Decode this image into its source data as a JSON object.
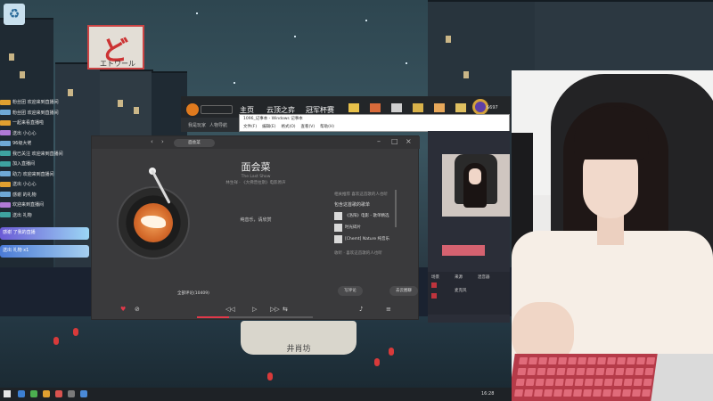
{
  "desktop": {
    "sign_text": "エトワール",
    "sign_glyph": "ど",
    "boat_text": "井肖坊"
  },
  "chat": {
    "messages": [
      {
        "badge": "#e0a030",
        "text": "粉丝团 欢迎来到直播间"
      },
      {
        "badge": "#6fa9d6",
        "text": "粉丝团 欢迎来到直播间"
      },
      {
        "badge": "#e0a030",
        "text": "一起来看直播啦"
      },
      {
        "badge": "#b07ad6",
        "text": "送出 小心心"
      },
      {
        "badge": "#6fa9d6",
        "text": "96级大佬"
      },
      {
        "badge": "#3ea3a0",
        "text": "我已关注 欢迎来到直播间"
      },
      {
        "badge": "#3ea3a0",
        "text": "加入直播间"
      },
      {
        "badge": "#6fa9d6",
        "text": "助力 欢迎来到直播间"
      },
      {
        "badge": "#e0a030",
        "text": "送出 小心心"
      },
      {
        "badge": "#6fa9d6",
        "text": "感谢 的礼物"
      },
      {
        "badge": "#b07ad6",
        "text": "欢迎来到直播间"
      },
      {
        "badge": "#3ea3a0",
        "text": "送出 礼物"
      }
    ],
    "gifts": [
      "感谢 了我的直播",
      "送出 礼物 x1"
    ]
  },
  "browser": {
    "nav": [
      "主页",
      "云顶之弈",
      "冠军杯赛"
    ],
    "sub_items": [
      "我是玩家",
      "人物导航"
    ],
    "icons": [
      {
        "label": "商城",
        "color": "#e8c14a"
      },
      {
        "label": "活动",
        "color": "#d86a3a"
      },
      {
        "label": "任务",
        "color": "#cfcfcf"
      },
      {
        "label": "战利品",
        "color": "#d9b24a"
      },
      {
        "label": "收藏",
        "color": "#e8a85a"
      },
      {
        "label": "$697",
        "color": "#e0c060"
      }
    ],
    "user_id": "$697"
  },
  "notepad": {
    "title": "1096_记事本 - Windows 记事本",
    "menu": [
      "文件(F)",
      "编辑(E)",
      "格式(O)",
      "查看(V)",
      "帮助(H)"
    ]
  },
  "player": {
    "tab_label": "面会菜",
    "song_title": "面会菜",
    "song_subtitle": "The Last Show",
    "song_meta": "林生祥 · 《大佛普拉斯》电影原声",
    "lyric": "纯音乐，请欣赏",
    "rec_header": "相关推荐 喜欢这首歌的人也听",
    "rec_title": "包含这首歌的歌单",
    "rec_items": [
      "《洛阳》电影 - 歌单精选",
      "时光碎片",
      "[Chemt] Nature 纯音乐"
    ],
    "rec_more": "收听 · 喜欢这首歌的人也听",
    "comment_label": "全部评论(10409)",
    "pill_left": "写评论",
    "pill_right": "去云圈聊",
    "progress": 0.28,
    "controls": [
      "♥",
      "⊘",
      "◁◁",
      "▷",
      "▷▷",
      "⇆",
      "♪",
      "≡"
    ]
  },
  "obs": {
    "panel_labels": [
      "场景",
      "来源",
      "混音器"
    ],
    "audio": "麦克风"
  },
  "taskbar": {
    "time": "16:28"
  }
}
